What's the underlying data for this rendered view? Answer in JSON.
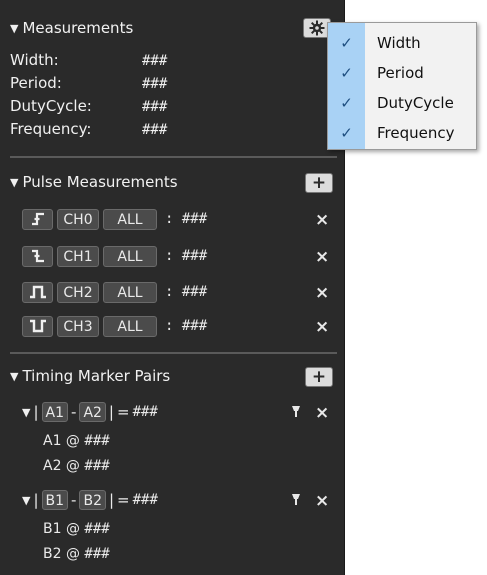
{
  "measurements": {
    "title": "Measurements",
    "settings_icon": "gear-icon",
    "rows": [
      {
        "label": "Width:",
        "value": "###"
      },
      {
        "label": "Period:",
        "value": "###"
      },
      {
        "label": "DutyCycle:",
        "value": "###"
      },
      {
        "label": "Frequency:",
        "value": "###"
      }
    ]
  },
  "pulse_measurements": {
    "title": "Pulse Measurements",
    "add_label": "+",
    "remove_label": "×",
    "separator": ":",
    "rows": [
      {
        "edge": "rising-edge",
        "channel": "CH0",
        "scope": "ALL",
        "value": "###"
      },
      {
        "edge": "falling-edge",
        "channel": "CH1",
        "scope": "ALL",
        "value": "###"
      },
      {
        "edge": "positive-pulse",
        "channel": "CH2",
        "scope": "ALL",
        "value": "###"
      },
      {
        "edge": "negative-pulse",
        "channel": "CH3",
        "scope": "ALL",
        "value": "###"
      }
    ]
  },
  "timing_marker_pairs": {
    "title": "Timing Marker Pairs",
    "add_label": "+",
    "remove_label": "×",
    "pairs": [
      {
        "a": "A1",
        "b": "A2",
        "dash": "-",
        "open_bar": "|",
        "close_bar": "|",
        "eq": "=",
        "value": "###",
        "sub": [
          {
            "label": "A1 @",
            "value": "###"
          },
          {
            "label": "A2 @",
            "value": "###"
          }
        ]
      },
      {
        "a": "B1",
        "b": "B2",
        "dash": "-",
        "open_bar": "|",
        "close_bar": "|",
        "eq": "=",
        "value": "###",
        "sub": [
          {
            "label": "B1 @",
            "value": "###"
          },
          {
            "label": "B2 @",
            "value": "###"
          }
        ]
      }
    ]
  },
  "dropdown_menu": {
    "items": [
      {
        "label": "Width",
        "checked": true
      },
      {
        "label": "Period",
        "checked": true
      },
      {
        "label": "DutyCycle",
        "checked": true
      },
      {
        "label": "Frequency",
        "checked": true
      }
    ],
    "check_glyph": "✓"
  },
  "colors": {
    "panel_bg": "#2a2a2a",
    "menu_highlight": "#a9d2f5"
  }
}
